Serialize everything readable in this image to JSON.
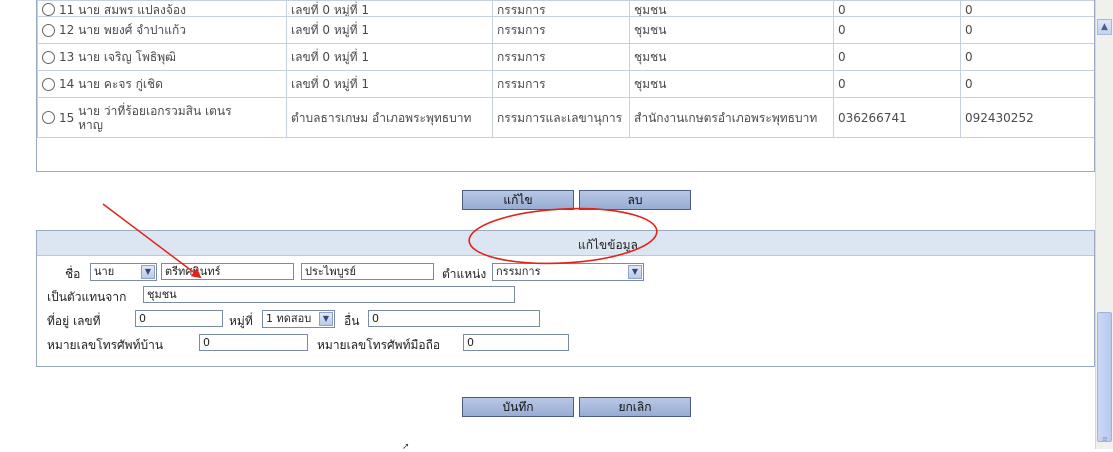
{
  "table": {
    "rows": [
      {
        "num": "11",
        "name": "นาย สมพร แปลงจ้อง",
        "address": "เลขที่ 0 หมู่ที่ 1",
        "position": "กรรมการ",
        "from": "ชุมชน",
        "home_phone": "0",
        "mobile": "0"
      },
      {
        "num": "12",
        "name": "นาย พยงศ์ จำปาแก้ว",
        "address": "เลขที่ 0 หมู่ที่ 1",
        "position": "กรรมการ",
        "from": "ชุมชน",
        "home_phone": "0",
        "mobile": "0"
      },
      {
        "num": "13",
        "name": "นาย เจริญ โพธิพุฒิ",
        "address": "เลขที่ 0 หมู่ที่ 1",
        "position": "กรรมการ",
        "from": "ชุมชน",
        "home_phone": "0",
        "mobile": "0"
      },
      {
        "num": "14",
        "name": "นาย คะจร กู่เชิด",
        "address": "เลขที่ 0 หมู่ที่ 1",
        "position": "กรรมการ",
        "from": "ชุมชน",
        "home_phone": "0",
        "mobile": "0"
      },
      {
        "num": "15",
        "name": "นาย ว่าที่ร้อยเอกรวมสิน เตนรหาญ",
        "address": "ตำบลธารเกษม อำเภอพระพุทธบาท",
        "position": "กรรมการและเลขานุการ",
        "from": "สำนักงานเกษตรอำเภอพระพุทธบาท",
        "home_phone": "036266741",
        "mobile": "092430252"
      }
    ]
  },
  "actions": {
    "edit": "แก้ไข",
    "delete": "ลบ"
  },
  "edit_form": {
    "title": "แก้ไขข้อมูล",
    "name_label": "ชื่อ",
    "prefix": "นาย",
    "first_name": "ตรีทศนินทร์",
    "last_name": "ประไพบูรย์",
    "position_label": "ตำแหน่ง",
    "position": "กรรมการ",
    "from_label": "เป็นตัวแทนจาก",
    "from": "ชุมชน",
    "address_label": "ที่อยู่ เลขที่",
    "house_no": "0",
    "moo_label": "หมู่ที่",
    "moo": "1 ทดสอบ",
    "other_label": "อื่น",
    "other": "0",
    "home_phone_label": "หมายเลขโทรศัพท์บ้าน",
    "home_phone": "0",
    "mobile_label": "หมายเลขโทรศัพท์มือถือ",
    "mobile": "0"
  },
  "footer": {
    "save": "บันทึก",
    "cancel": "ยกเลิก"
  },
  "colors": {
    "accent": "#98acd4",
    "header": "#dce6f2",
    "annotation": "#e0241b"
  }
}
